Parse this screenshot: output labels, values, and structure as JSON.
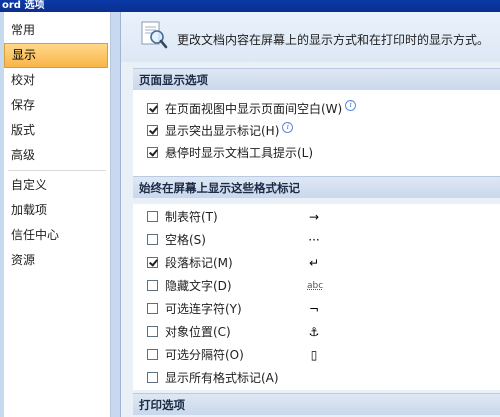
{
  "window": {
    "title": "ord 选项"
  },
  "sidebar": {
    "items": [
      {
        "label": "常用"
      },
      {
        "label": "显示"
      },
      {
        "label": "校对"
      },
      {
        "label": "保存"
      },
      {
        "label": "版式"
      },
      {
        "label": "高级"
      },
      {
        "label": "自定义"
      },
      {
        "label": "加载项"
      },
      {
        "label": "信任中心"
      },
      {
        "label": "资源"
      }
    ],
    "selected": "显示"
  },
  "header": {
    "description": "更改文档内容在屏幕上的显示方式和在打印时的显示方式。",
    "icon": "document-magnifier-icon"
  },
  "sections": {
    "page_display": {
      "title": "页面显示选项",
      "options": [
        {
          "label": "在页面视图中显示页面间空白(W)",
          "checked": true,
          "info": "i"
        },
        {
          "label": "显示突出显示标记(H)",
          "checked": true,
          "info": "i"
        },
        {
          "label": "悬停时显示文档工具提示(L)",
          "checked": true
        }
      ]
    },
    "formatting_marks": {
      "title": "始终在屏幕上显示这些格式标记",
      "options": [
        {
          "label": "制表符(T)",
          "checked": false,
          "symbol": "→"
        },
        {
          "label": "空格(S)",
          "checked": false,
          "symbol": "···"
        },
        {
          "label": "段落标记(M)",
          "checked": true,
          "symbol": "↵"
        },
        {
          "label": "隐藏文字(D)",
          "checked": false,
          "symbol": "abc"
        },
        {
          "label": "可选连字符(Y)",
          "checked": false,
          "symbol": "¬"
        },
        {
          "label": "对象位置(C)",
          "checked": false,
          "symbol": "⚓"
        },
        {
          "label": "可选分隔符(O)",
          "checked": false,
          "symbol": "▯"
        },
        {
          "label": "显示所有格式标记(A)",
          "checked": false
        }
      ]
    },
    "print": {
      "title": "打印选项"
    }
  }
}
